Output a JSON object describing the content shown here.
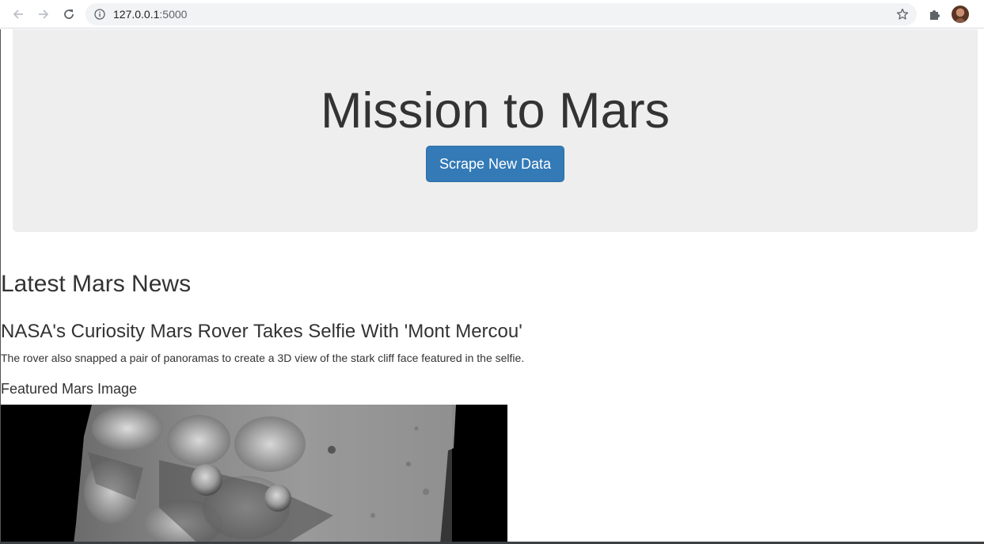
{
  "browser": {
    "url_host": "127.0.0.1",
    "url_port": ":5000",
    "icons": {
      "back": "arrow-left-icon",
      "forward": "arrow-right-icon",
      "reload": "reload-icon",
      "site_info": "info-icon",
      "bookmark": "star-icon",
      "extensions": "puzzle-icon",
      "profile": "avatar"
    }
  },
  "jumbotron": {
    "title": "Mission to Mars",
    "scrape_button_label": "Scrape New Data",
    "button_color": "#337ab7",
    "background_color": "#eeeeee"
  },
  "news": {
    "section_title": "Latest Mars News",
    "headline": "NASA's Curiosity Mars Rover Takes Selfie With 'Mont Mercou'",
    "teaser": "The rover also snapped a pair of panoramas to create a 3D view of the stark cliff face featured in the selfie."
  },
  "featured_image": {
    "section_title": "Featured Mars Image"
  }
}
